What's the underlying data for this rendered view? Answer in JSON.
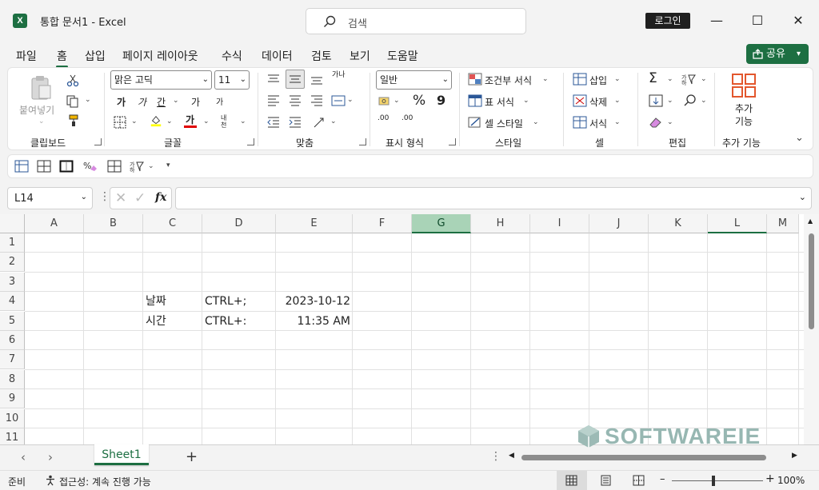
{
  "window": {
    "app_icon": "X",
    "title": "통합 문서1  -  Excel",
    "search_placeholder": "검색",
    "login_label": "로그인",
    "minimize": "—",
    "maximize": "☐",
    "close": "✕"
  },
  "menu_tabs": [
    "파일",
    "홈",
    "삽입",
    "페이지 레이아웃",
    "수식",
    "데이터",
    "검토",
    "보기",
    "도움말"
  ],
  "active_tab": "홈",
  "share_label": "공유",
  "ribbon": {
    "clipboard": {
      "paste": "붙여넣기",
      "label": "클립보드"
    },
    "font": {
      "name": "맑은 고딕",
      "size": "11",
      "bold": "가",
      "italic": "가",
      "underline": "간",
      "grow": "가",
      "shrink": "가",
      "label": "글꼴",
      "wrap_small": "내천"
    },
    "alignment": {
      "label": "맞춤",
      "wrap_icon": "가나"
    },
    "number": {
      "format": "일반",
      "percent": "%",
      "comma": "9",
      "label": "표시 형식",
      "inc": ".00",
      "dec": ".00"
    },
    "styles": {
      "conditional": "조건부 서식",
      "table": "표 서식",
      "cell_style": "셀 스타일",
      "label": "스타일"
    },
    "cells": {
      "insert": "삽입",
      "delete": "삭제",
      "format": "서식",
      "label": "셀"
    },
    "editing": {
      "sum": "Σ",
      "label": "편집"
    },
    "addins": {
      "button": "추가\n기능",
      "line1": "추가",
      "line2": "기능",
      "label": "추가 기능"
    }
  },
  "formula_bar": {
    "name_box": "L14",
    "fx": "fx",
    "formula": ""
  },
  "columns": [
    "A",
    "B",
    "C",
    "D",
    "E",
    "F",
    "G",
    "H",
    "I",
    "J",
    "K",
    "L",
    "M"
  ],
  "selected_column": "G",
  "current_column": "L",
  "rows": [
    "1",
    "2",
    "3",
    "4",
    "5",
    "6",
    "7",
    "8",
    "9",
    "10",
    "11"
  ],
  "cells": {
    "C4": "날짜",
    "D4": "CTRL+;",
    "E4": "2023-10-12",
    "C5": "시간",
    "D5": "CTRL+:",
    "E5": "11:35 AM"
  },
  "sheets": [
    "Sheet1"
  ],
  "status": {
    "ready": "준비",
    "accessibility": "접근성: 계속 진행 가능",
    "zoom": "100%"
  },
  "watermark": "SOFTWAREIE"
}
